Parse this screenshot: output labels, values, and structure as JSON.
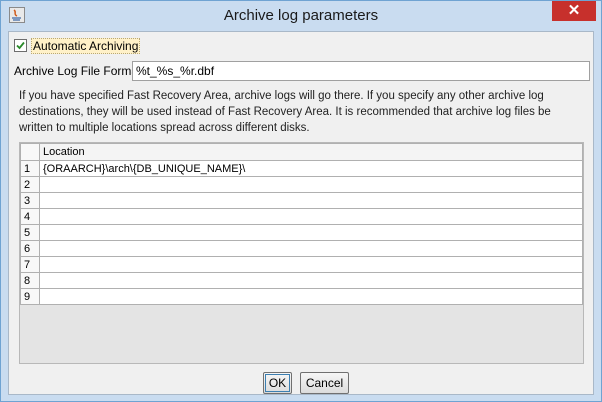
{
  "window": {
    "title": "Archive log parameters",
    "close_glyph": "✕"
  },
  "automatic_archiving": {
    "label": "Automatic Archiving",
    "checked": true
  },
  "log_file_format": {
    "label": "Archive Log File Format",
    "value": "%t_%s_%r.dbf"
  },
  "info_text": "If you have specified Fast Recovery Area, archive logs will go there. If you specify any other archive log destinations, they will be used instead of Fast Recovery Area. It is recommended that archive log files be written to multiple locations spread across different disks.",
  "table": {
    "header": "Location",
    "rows": [
      {
        "num": "1",
        "location": "{ORAARCH}\\arch\\{DB_UNIQUE_NAME}\\"
      },
      {
        "num": "2",
        "location": ""
      },
      {
        "num": "3",
        "location": ""
      },
      {
        "num": "4",
        "location": ""
      },
      {
        "num": "5",
        "location": ""
      },
      {
        "num": "6",
        "location": ""
      },
      {
        "num": "7",
        "location": ""
      },
      {
        "num": "8",
        "location": ""
      },
      {
        "num": "9",
        "location": ""
      }
    ]
  },
  "buttons": {
    "ok": "OK",
    "cancel": "Cancel"
  },
  "icons": {
    "app": "java-app-icon",
    "check": "check-icon",
    "close": "close-icon"
  },
  "colors": {
    "titlebar": "#c9dcf0",
    "close": "#c7302c",
    "focus": "#fff1c8"
  }
}
